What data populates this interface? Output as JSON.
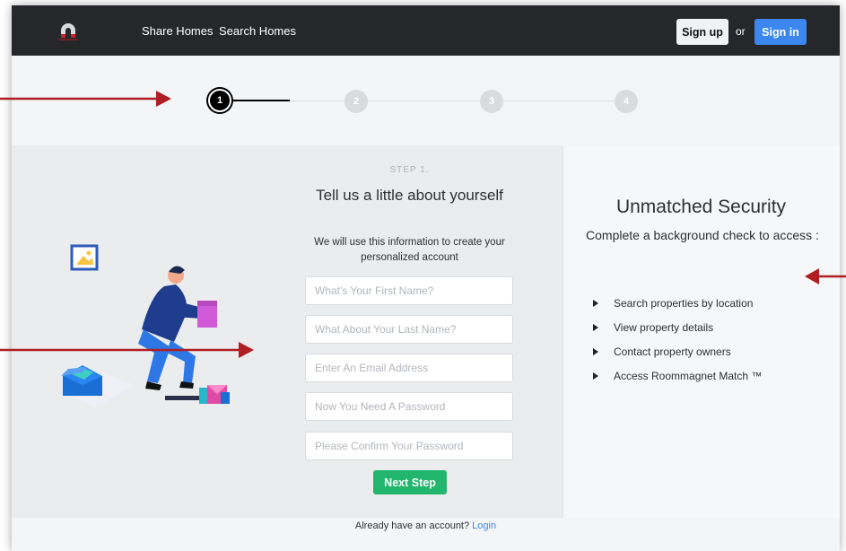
{
  "nav": {
    "links": [
      "Share Homes",
      "Search Homes"
    ],
    "signup_label": "Sign up",
    "or_label": "or",
    "signin_label": "Sign in"
  },
  "stepper": {
    "steps": [
      "1",
      "2",
      "3",
      "4"
    ],
    "active_step": 1
  },
  "form": {
    "step_label": "STEP 1.",
    "heading": "Tell us a little about yourself",
    "subtext": "We will use this information to create your personalized account",
    "fields": [
      {
        "placeholder": "What's Your First Name?"
      },
      {
        "placeholder": "What About Your Last Name?"
      },
      {
        "placeholder": "Enter An Email Address"
      },
      {
        "placeholder": "Now You Need A Password"
      },
      {
        "placeholder": "Please Confirm Your Password"
      }
    ],
    "next_label": "Next Step"
  },
  "security": {
    "title": "Unmatched Security",
    "subtitle": "Complete a background check to access :",
    "features": [
      "Search properties by location",
      "View property details",
      "Contact property owners",
      "Access Roommagnet Match ™"
    ]
  },
  "footer": {
    "prompt": "Already have an account?",
    "login_label": "Login"
  },
  "colors": {
    "navbar": "#25272a",
    "signin": "#3c86ef",
    "next": "#22b56c",
    "arrow": "#b01d22"
  }
}
